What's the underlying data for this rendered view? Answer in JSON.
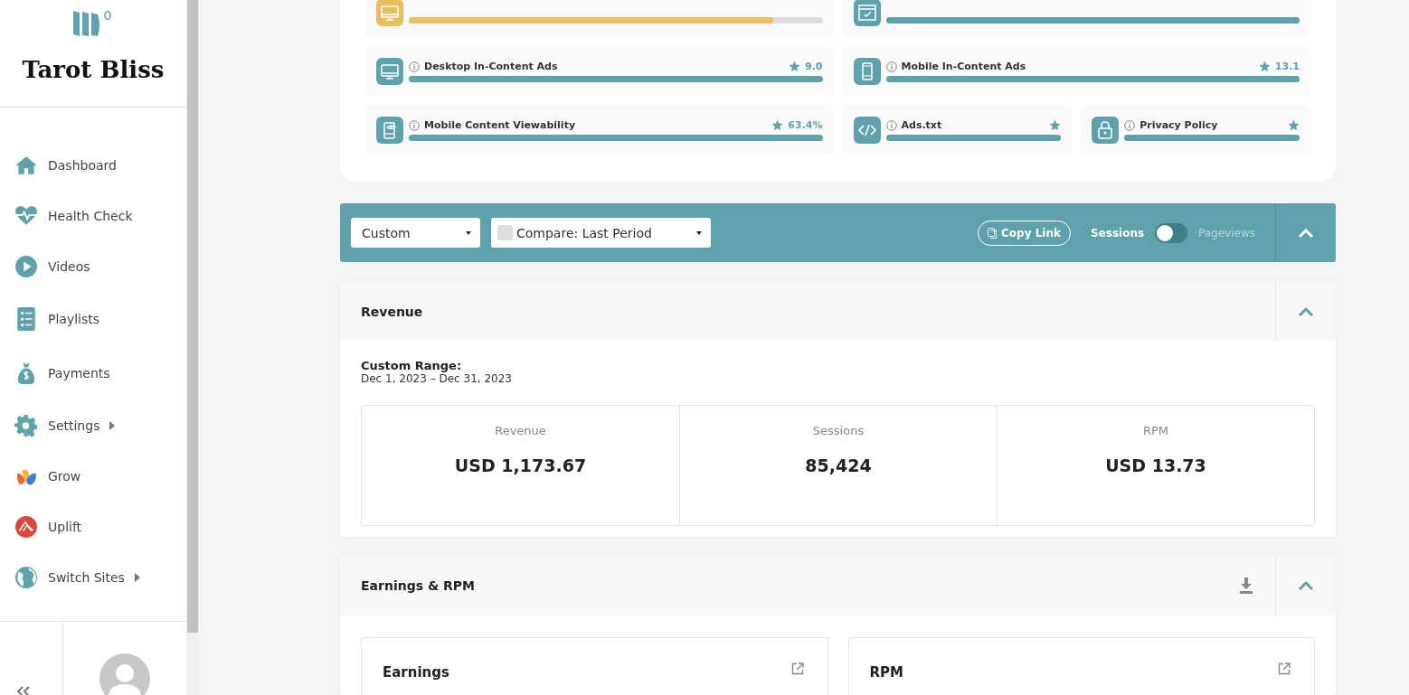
{
  "sidebar": {
    "site_name": "Tarot Bliss",
    "items": [
      {
        "label": "Dashboard",
        "kind": "home",
        "submenu": false
      },
      {
        "label": "Health Check",
        "kind": "heartbeat",
        "submenu": false
      },
      {
        "label": "Videos",
        "kind": "play",
        "submenu": false
      },
      {
        "label": "Playlists",
        "kind": "list",
        "submenu": false
      },
      {
        "label": "Payments",
        "kind": "moneybag",
        "submenu": false
      },
      {
        "label": "Settings",
        "kind": "gear",
        "submenu": true
      },
      {
        "label": "Grow",
        "kind": "grow",
        "submenu": false
      },
      {
        "label": "Uplift",
        "kind": "uplift",
        "submenu": false
      },
      {
        "label": "Switch Sites",
        "kind": "globe",
        "submenu": true
      }
    ]
  },
  "health_check": {
    "items": [
      {
        "kind": "desktop",
        "level": 0.88,
        "color": "#e8bf60"
      },
      {
        "kind": "checklist",
        "level": 1,
        "color": "#5ea3ab"
      },
      {
        "kind": "desktop",
        "title": "Desktop In-Content Ads",
        "score": "9.0",
        "level": 1,
        "color": "#5ea3ab"
      },
      {
        "kind": "mobile",
        "title": "Mobile In-Content Ads",
        "score": "13.1",
        "level": 1,
        "color": "#5ea3ab"
      },
      {
        "kind": "mobile-eye",
        "title": "Mobile Content Viewability",
        "score": "63.4%",
        "level": 1,
        "color": "#5ea3ab"
      },
      {
        "kind": "code",
        "title": "Ads.txt",
        "level": 1,
        "color": "#5ea3ab"
      },
      {
        "kind": "lock",
        "title": "Privacy Policy",
        "level": 1,
        "color": "#5ea3ab"
      }
    ]
  },
  "filter_bar": {
    "range": "Custom",
    "compare": {
      "label": "Compare: Last Period",
      "checked": false
    },
    "copy_link": "Copy Link",
    "metric_toggle": [
      {
        "label": "Sessions",
        "selected": true
      },
      {
        "label": "Pageviews",
        "selected": false
      }
    ]
  },
  "revenue": {
    "title": "Revenue",
    "range_label": "Custom Range:",
    "range": "Dec 1, 2023 – Dec 31, 2023",
    "stats": [
      {
        "label": "Revenue",
        "value": "USD 1,173.67"
      },
      {
        "label": "Sessions",
        "value": "85,424"
      },
      {
        "label": "RPM",
        "value": "USD 13.73"
      }
    ]
  },
  "earnings_rpm": {
    "title": "Earnings & RPM",
    "cards": [
      "Earnings",
      "RPM"
    ]
  }
}
